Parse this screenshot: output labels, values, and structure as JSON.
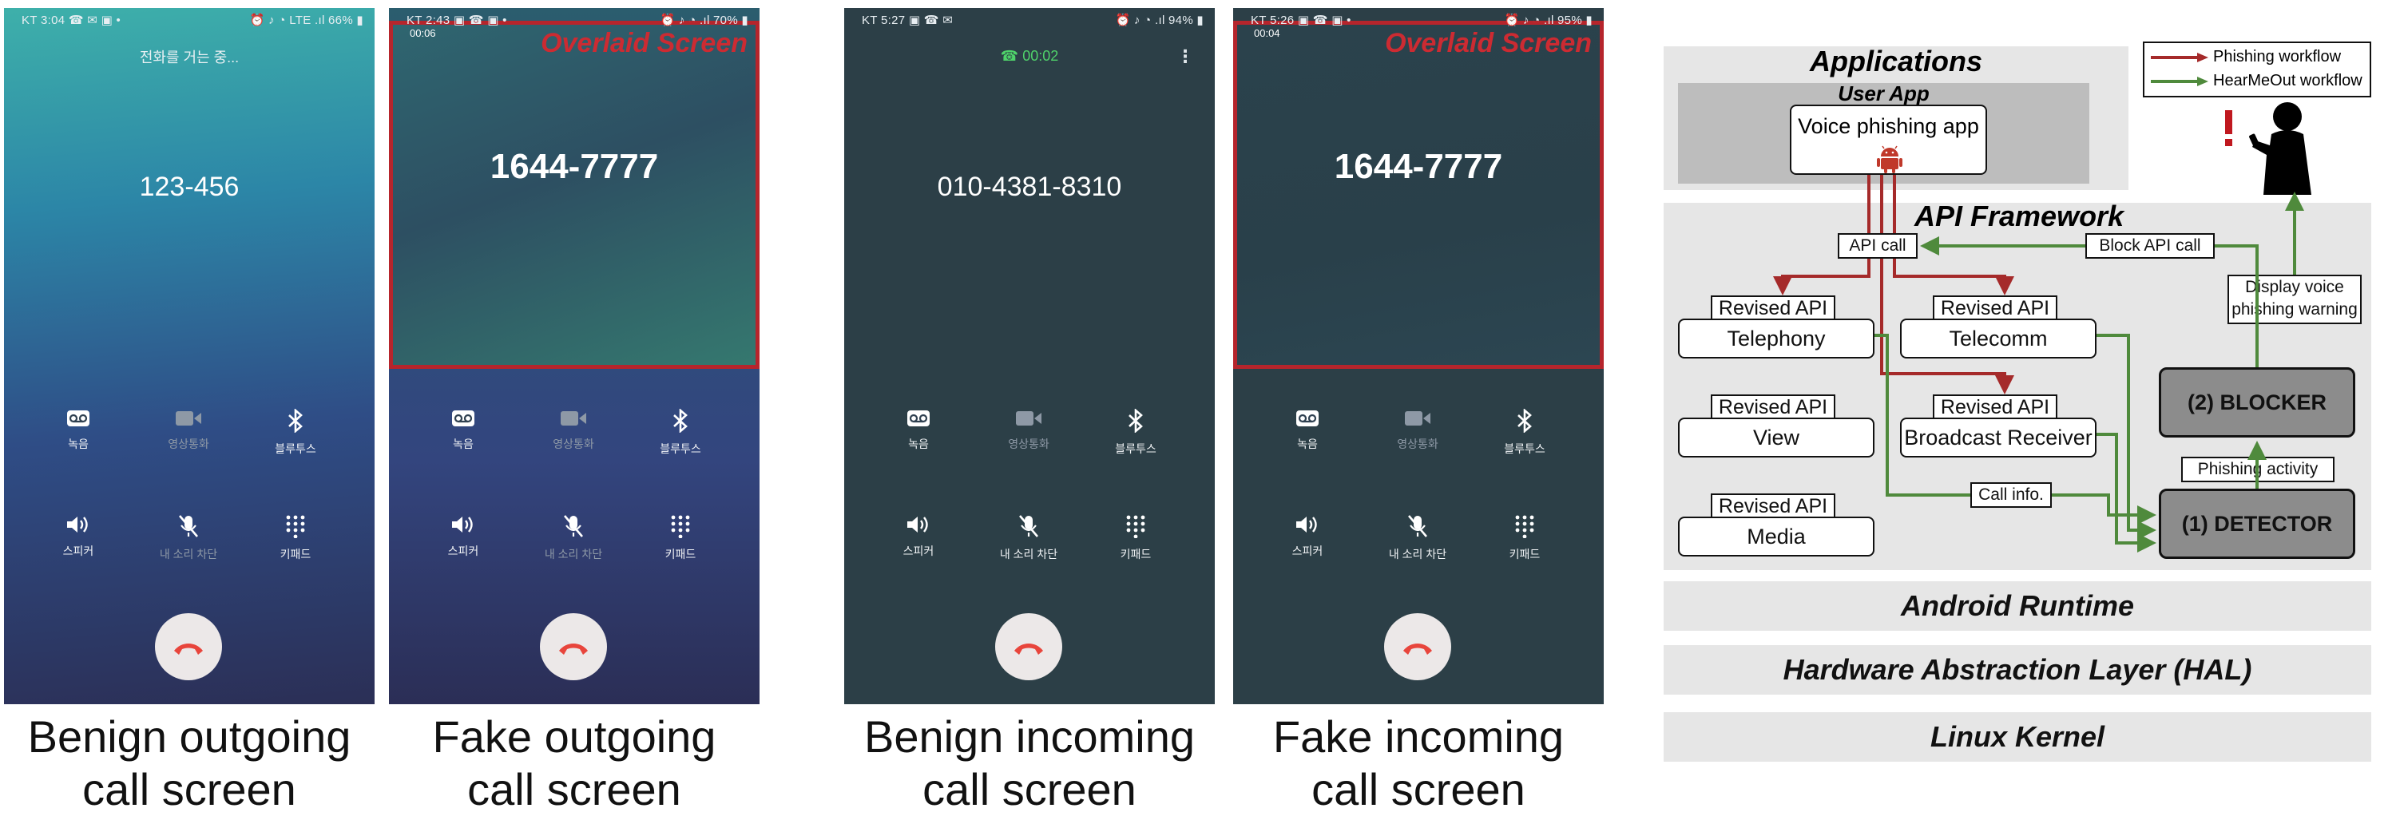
{
  "phones": [
    {
      "status_left": "KT 3:04 ☎ ✉ ▣ •",
      "status_right": "⏰ ♪ ◔ LTE .ıl 66% ▮",
      "top_text": "전화를 거는 중...",
      "number": "123-456",
      "buttons": [
        {
          "label": "녹음",
          "icon": "voicemail-icon"
        },
        {
          "label": "영상통화",
          "icon": "video-icon"
        },
        {
          "label": "블루투스",
          "icon": "bluetooth-icon"
        },
        {
          "label": "스피커",
          "icon": "speaker-icon"
        },
        {
          "label": "내 소리 차단",
          "icon": "mic-off-icon"
        },
        {
          "label": "키패드",
          "icon": "keypad-icon"
        }
      ],
      "caption": "Benign outgoing call screen",
      "caption_lines": [
        "Benign outgoing",
        "call screen"
      ]
    },
    {
      "status_left": "KT 2:43 ▣ ☎ ▣ •",
      "status_right": "⏰ ♪ ◔ .ıl 70% ▮",
      "timer": "00:06",
      "overlay_label": "Overlaid Screen",
      "number": "1644-7777",
      "buttons": [
        {
          "label": "녹음",
          "icon": "voicemail-icon"
        },
        {
          "label": "영상통화",
          "icon": "video-icon"
        },
        {
          "label": "블루투스",
          "icon": "bluetooth-icon"
        },
        {
          "label": "스피커",
          "icon": "speaker-icon"
        },
        {
          "label": "내 소리 차단",
          "icon": "mic-off-icon"
        },
        {
          "label": "키패드",
          "icon": "keypad-icon"
        }
      ],
      "caption_lines": [
        "Fake outgoing",
        "call screen"
      ]
    },
    {
      "status_left": "KT 5:27 ▣ ☎ ✉",
      "status_right": "⏰ ♪ ◔ .ıl 94% ▮",
      "green_timer": "☎ 00:02",
      "menu": "⋮",
      "number": "010-4381-8310",
      "buttons": [
        {
          "label": "녹음",
          "icon": "voicemail-icon"
        },
        {
          "label": "영상통화",
          "icon": "video-icon"
        },
        {
          "label": "블루투스",
          "icon": "bluetooth-icon"
        },
        {
          "label": "스피커",
          "icon": "speaker-icon"
        },
        {
          "label": "내 소리 차단",
          "icon": "mic-off-icon"
        },
        {
          "label": "키패드",
          "icon": "keypad-icon"
        }
      ],
      "caption_lines": [
        "Benign incoming",
        "call screen"
      ]
    },
    {
      "status_left": "KT 5:26 ▣ ☎ ▣ •",
      "status_right": "⏰ ♪ ◔ .ıl 95% ▮",
      "timer": "00:04",
      "overlay_label": "Overlaid Screen",
      "number": "1644-7777",
      "buttons": [
        {
          "label": "녹음",
          "icon": "voicemail-icon"
        },
        {
          "label": "영상통화",
          "icon": "video-icon"
        },
        {
          "label": "블루투스",
          "icon": "bluetooth-icon"
        },
        {
          "label": "스피커",
          "icon": "speaker-icon"
        },
        {
          "label": "내 소리 차단",
          "icon": "mic-off-icon"
        },
        {
          "label": "키패드",
          "icon": "keypad-icon"
        }
      ],
      "caption_lines": [
        "Fake incoming",
        "call screen"
      ]
    }
  ],
  "arch": {
    "applications": "Applications",
    "user_app": "User App",
    "voice_phishing_app": "Voice phishing app",
    "api_framework": "API Framework",
    "api_call": "API call",
    "block_api_call": "Block API call",
    "revised_api": "Revised API",
    "apis": [
      "Telephony",
      "Telecomm",
      "View",
      "Broadcast Receiver",
      "Media"
    ],
    "call_info": "Call info.",
    "phishing_activity": "Phishing activity",
    "display_warning_1": "Display voice",
    "display_warning_2": "phishing warning",
    "blocker": "(2) BLOCKER",
    "detector": "(1) DETECTOR",
    "android_runtime": "Android Runtime",
    "hal": "Hardware Abstraction Layer (HAL)",
    "linux_kernel": "Linux Kernel",
    "legend": {
      "phishing": "Phishing workflow",
      "hearmeout": "HearMeOut workflow"
    },
    "colors": {
      "phishing": "#a52a2a",
      "hearmeout": "#4f8a3c",
      "android": "#c0392b"
    }
  }
}
